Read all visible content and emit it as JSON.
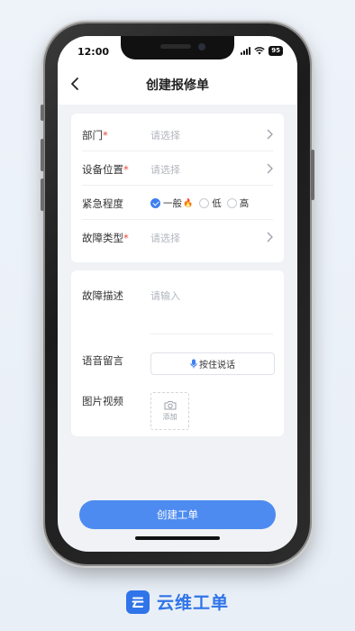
{
  "status_bar": {
    "time": "12:00",
    "battery": "95"
  },
  "header": {
    "title": "创建报修单"
  },
  "form": {
    "department": {
      "label": "部门",
      "required_mark": "*",
      "placeholder": "请选择"
    },
    "location": {
      "label": "设备位置",
      "required_mark": "*",
      "placeholder": "请选择"
    },
    "urgency": {
      "label": "紧急程度",
      "options": [
        {
          "label": "一般",
          "selected": true
        },
        {
          "label": "低",
          "selected": false
        },
        {
          "label": "高",
          "selected": false
        }
      ]
    },
    "fault_type": {
      "label": "故障类型",
      "required_mark": "*",
      "placeholder": "请选择"
    },
    "description": {
      "label": "故障描述",
      "placeholder": "请输入"
    },
    "voice": {
      "label": "语音留言",
      "button": "按住说话"
    },
    "media": {
      "label": "图片视频",
      "add": "添加"
    }
  },
  "submit": {
    "label": "创建工单"
  },
  "brand": {
    "name": "云维工单"
  },
  "colors": {
    "accent": "#4d8bf0",
    "brand": "#2f74e8",
    "required": "#e54a3c",
    "flame": "#f08a4b"
  },
  "icons": [
    "back-chevron-icon",
    "chevron-right-icon",
    "check-icon",
    "flame-icon",
    "microphone-icon",
    "camera-icon",
    "signal-icon",
    "wifi-icon",
    "battery-icon",
    "brand-logo-icon"
  ]
}
